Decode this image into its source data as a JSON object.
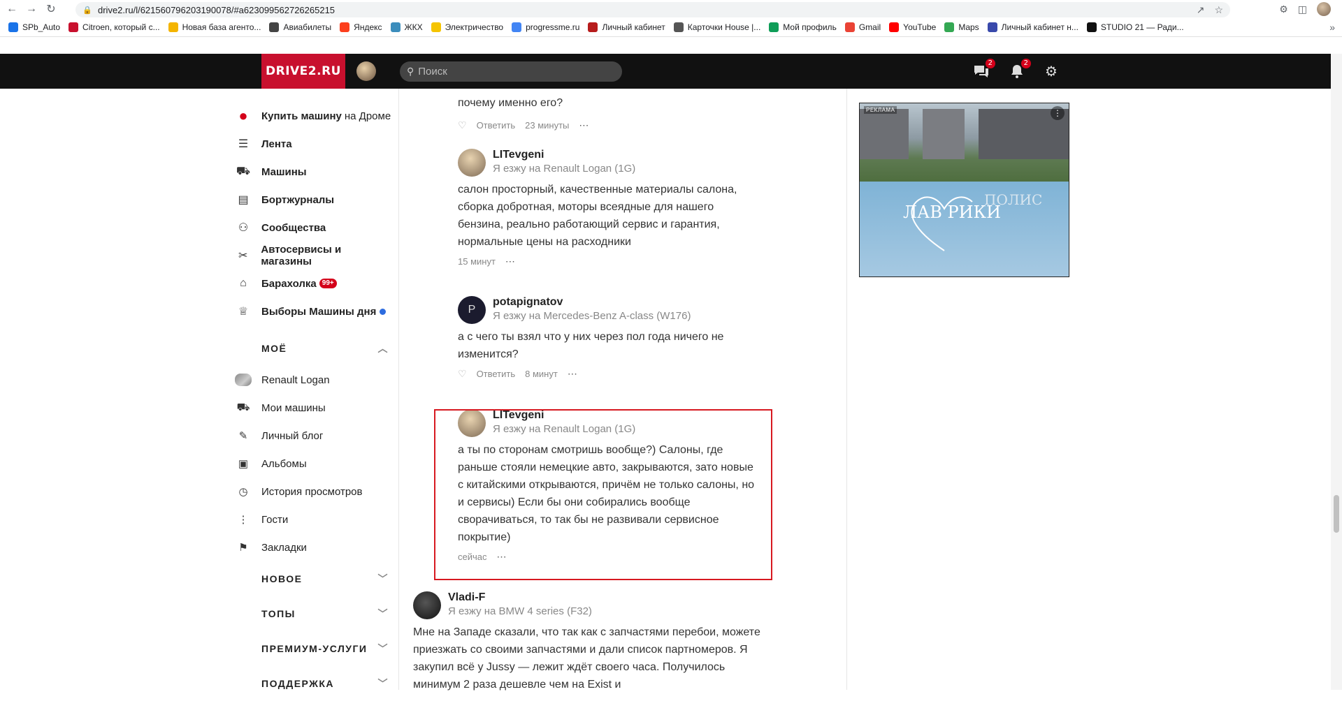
{
  "browser": {
    "url": "drive2.ru/l/621560796203190078/#a623099562726265215",
    "bookmarks": [
      {
        "label": "SPb_Auto",
        "color": "#1a73e8"
      },
      {
        "label": "Citroen, который с...",
        "color": "#c8102e"
      },
      {
        "label": "Новая база агенто...",
        "color": "#f4b400"
      },
      {
        "label": "Авиабилеты",
        "color": "#444444"
      },
      {
        "label": "Яндекс",
        "color": "#fc3f1d"
      },
      {
        "label": "ЖКХ",
        "color": "#3c8dbc"
      },
      {
        "label": "Электричество",
        "color": "#f5c400"
      },
      {
        "label": "progressme.ru",
        "color": "#4285f4"
      },
      {
        "label": "Личный кабинет",
        "color": "#b71c1c"
      },
      {
        "label": "Карточки House |...",
        "color": "#555555"
      },
      {
        "label": "Мой профиль",
        "color": "#0f9d58"
      },
      {
        "label": "Gmail",
        "color": "#ea4335"
      },
      {
        "label": "YouTube",
        "color": "#ff0000"
      },
      {
        "label": "Maps",
        "color": "#34a853"
      },
      {
        "label": "Личный кабинет н...",
        "color": "#3949ab"
      },
      {
        "label": "STUDIO 21 — Ради...",
        "color": "#111111"
      }
    ],
    "bookmarks_more": "»"
  },
  "header": {
    "logo": "DRIVE2.RU",
    "search_placeholder": "Поиск",
    "messages_badge": "2",
    "notifications_badge": "2"
  },
  "sidebar": {
    "main": [
      {
        "label": "Купить машину",
        "extra": "на Дроме",
        "icon": "drom-icon"
      },
      {
        "label": "Лента",
        "icon": "feed-icon"
      },
      {
        "label": "Машины",
        "icon": "car-icon"
      },
      {
        "label": "Бортжурналы",
        "icon": "book-icon"
      },
      {
        "label": "Сообщества",
        "icon": "people-icon"
      },
      {
        "label": "Автосервисы и магазины",
        "icon": "tools-icon"
      },
      {
        "label": "Барахолка",
        "badge": "99+",
        "icon": "market-icon"
      },
      {
        "label": "Выборы Машины дня",
        "icon": "trophy-icon"
      }
    ],
    "my_section": "МОЁ",
    "my_items": [
      {
        "label": "Renault Logan",
        "icon": "car-thumb"
      },
      {
        "label": "Мои машины",
        "icon": "cars-icon"
      },
      {
        "label": "Личный блог",
        "icon": "blog-icon"
      },
      {
        "label": "Альбомы",
        "icon": "album-icon"
      },
      {
        "label": "История просмотров",
        "icon": "history-icon"
      },
      {
        "label": "Гости",
        "icon": "footprints-icon"
      },
      {
        "label": "Закладки",
        "icon": "bookmark-icon"
      }
    ],
    "sections": [
      "НОВОЕ",
      "ТОПЫ",
      "ПРЕМИУМ-УСЛУГИ",
      "ПОДДЕРЖКА"
    ]
  },
  "feed": {
    "reply_actions": {
      "reply": "Ответить",
      "more": "⋯"
    },
    "top_fragment": {
      "text": "почему именно его?",
      "time": "23 минуты"
    },
    "comments": [
      {
        "author": "LITevgeni",
        "car": "Я езжу на Renault Logan (1G)",
        "text": "салон просторный, качественные материалы салона, сборка добротная, моторы всеядные для нашего бензина, реально работающий сервис и гарантия, нормальные цены на расходники",
        "time": "15 минут"
      },
      {
        "author": "potapignatov",
        "avatar_letter": "P",
        "car": "Я езжу на Mercedes-Benz A-class (W176)",
        "text": "а с чего ты взял что у них через пол года ничего не изменится?",
        "time": "8 минут"
      },
      {
        "author": "LITevgeni",
        "car": "Я езжу на Renault Logan (1G)",
        "text": "а ты по сторонам смотришь вообще?) Салоны, где раньше стояли немецкие авто, закрываются, зато новые с китайскими открываются, причём не только салоны, но и сервисы) Если бы они собирались вообще сворачиваться, то так бы не развивали сервисное покрытие)",
        "time": "сейчас"
      },
      {
        "author": "Vladi-F",
        "car": "Я езжу на BMW 4 series (F32)",
        "text": "Мне на Западе сказали, что так как с запчастями перебои, можете приезжать со своими запчастями и дали список партномеров. Я закупил всё у Jussy — лежит ждёт своего часа. Получилось минимум 2 раза дешевле чем на Exist и"
      }
    ]
  },
  "ad": {
    "label": "РЕКЛАМА",
    "title": "ЛАВ  РИКИ",
    "subtitle": "ПОЛИС"
  },
  "colors": {
    "brand": "#c8102e",
    "header_bg": "#111111",
    "highlight": "#d71920"
  }
}
